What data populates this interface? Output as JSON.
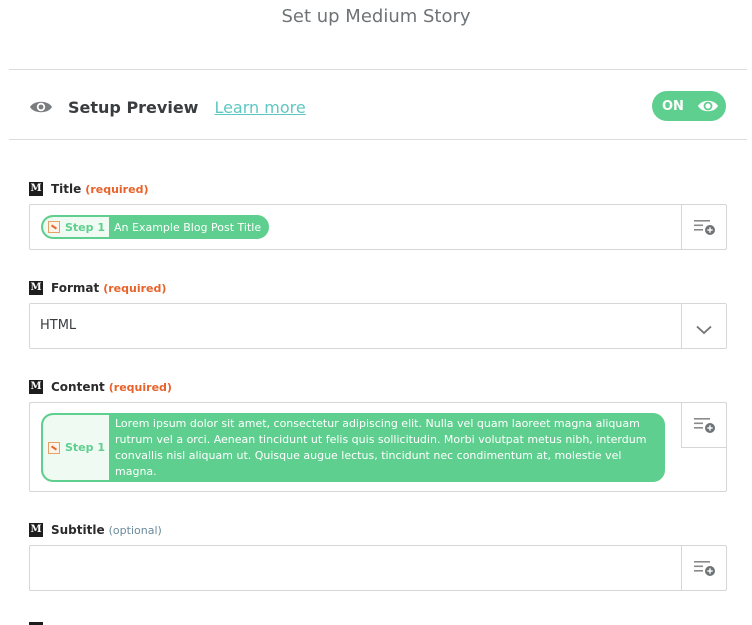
{
  "header": {
    "title": "Set up Medium Story"
  },
  "preview": {
    "label": "Setup Preview",
    "learn_more": "Learn more",
    "toggle_label": "ON"
  },
  "fields": {
    "title": {
      "label": "Title",
      "requirement": "(required)",
      "step_label": "Step 1",
      "value": "An Example Blog Post Title"
    },
    "format": {
      "label": "Format",
      "requirement": "(required)",
      "value": "HTML"
    },
    "content": {
      "label": "Content",
      "requirement": "(required)",
      "step_label": "Step 1",
      "value": "Lorem ipsum dolor sit amet, consectetur adipiscing elit. Nulla vel quam laoreet magna aliquam rutrum vel a orci. Aenean tincidunt ut felis quis sollicitudin. Morbi volutpat metus nibh, interdum convallis nisl aliquam ut. Quisque augue lectus, tincidunt nec condimentum at, molestie vel magna."
    },
    "subtitle": {
      "label": "Subtitle",
      "requirement": "(optional)",
      "value": ""
    }
  },
  "colors": {
    "accent_green": "#5ecf8e",
    "link_teal": "#5fc7c2",
    "required_orange": "#e8632b"
  },
  "icons": {
    "preview": "eye-icon",
    "toggle": "eye-icon",
    "app": "medium-logo-icon",
    "insert": "insert-data-icon",
    "dropdown": "chevron-down-icon",
    "step": "app-step-icon"
  }
}
